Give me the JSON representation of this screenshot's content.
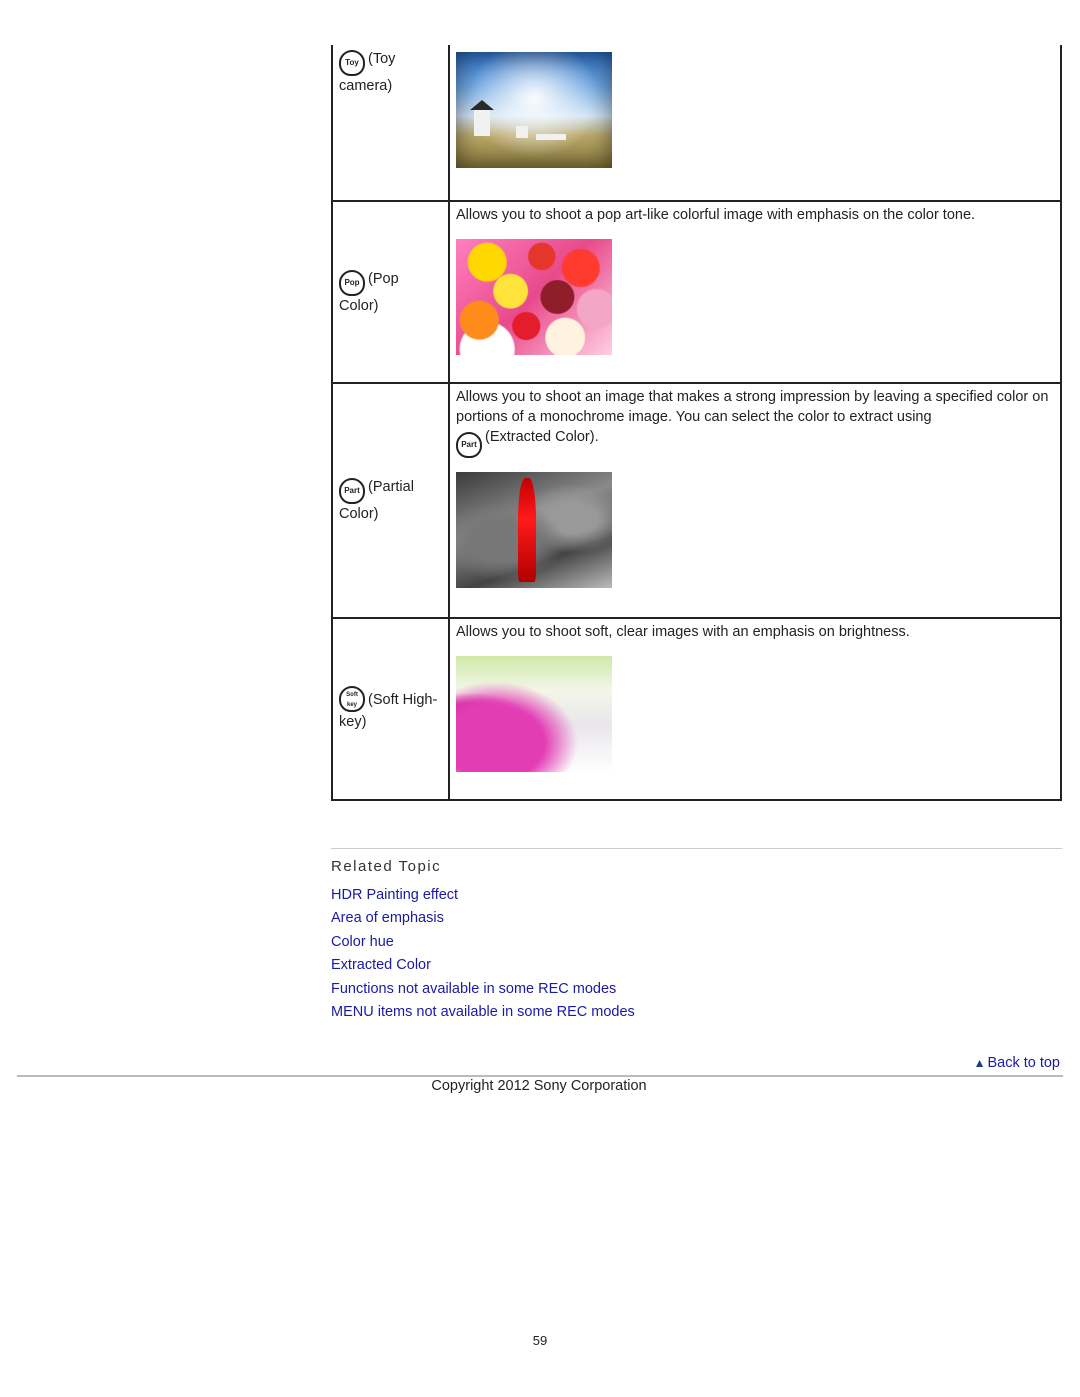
{
  "effects": [
    {
      "icon_label": "Toy",
      "name": "(Toy camera)",
      "description": "",
      "image": "toy-camera-sample"
    },
    {
      "icon_label": "Pop",
      "name": "(Pop Color)",
      "description": "Allows you to shoot a pop art-like colorful image with emphasis on the color tone.",
      "image": "pop-color-sample"
    },
    {
      "icon_label": "Part",
      "name": "(Partial Color)",
      "description": "Allows you to shoot an image that makes a strong impression by leaving a specified color on portions of a monochrome image. You can select the color to extract using",
      "inline_icon_label": "Part",
      "inline_icon_text": "(Extracted Color).",
      "image": "partial-color-sample"
    },
    {
      "icon_label": "Soft key",
      "name": "(Soft High-key)",
      "description": "Allows you to shoot soft, clear images with an emphasis on brightness.",
      "image": "soft-high-key-sample"
    }
  ],
  "related": {
    "title": "Related Topic",
    "links": [
      "HDR Painting effect",
      "Area of emphasis",
      "Color hue",
      "Extracted Color",
      "Functions not available in some REC modes",
      "MENU items not available in some REC modes"
    ]
  },
  "footer": {
    "back_to_top": "Back to top",
    "back_icon": "triangle-up",
    "copyright": "Copyright 2012 Sony Corporation",
    "page_number": "59"
  },
  "colors": {
    "link": "#1a1aa6",
    "border": "#222222"
  }
}
